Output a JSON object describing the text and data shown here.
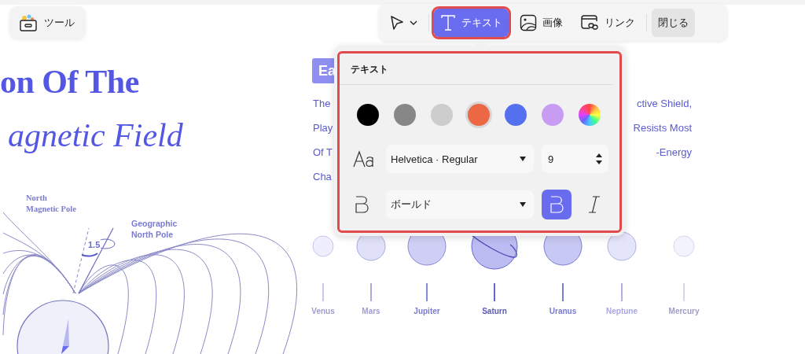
{
  "tool_button": {
    "label": "ツール"
  },
  "toolbar": {
    "items": [
      {
        "kind": "select",
        "selected": false
      },
      {
        "kind": "text",
        "label": "テキスト",
        "selected": true
      },
      {
        "kind": "image",
        "label": "画像",
        "selected": false
      },
      {
        "kind": "link",
        "label": "リンク",
        "selected": false
      },
      {
        "kind": "close",
        "label": "閉じる",
        "selected": false
      }
    ]
  },
  "text_popover": {
    "title": "テキスト",
    "colors": [
      {
        "kind": "solid",
        "color": "#000000",
        "selected": false
      },
      {
        "kind": "solid",
        "color": "#878787",
        "selected": false
      },
      {
        "kind": "solid",
        "color": "#cdcdcd",
        "selected": false
      },
      {
        "kind": "solid",
        "color": "#ec6744",
        "selected": true
      },
      {
        "kind": "solid",
        "color": "#5470ef",
        "selected": false
      },
      {
        "kind": "solid",
        "color": "#c99cf4",
        "selected": false
      },
      {
        "kind": "spectrum",
        "selected": false
      }
    ],
    "font": "Helvetica · Regular",
    "size": "9",
    "weight": "ボールド",
    "bold": true,
    "italic": false
  },
  "canvas": {
    "heading_lines": [
      "on Of The",
      "agnetic Field"
    ],
    "badge": "Ea",
    "paragraph_left": [
      "The",
      "Play",
      "Of T",
      "Cha"
    ],
    "paragraph_right": [
      "ctive Shield,",
      "Resists Most",
      "-Energy"
    ],
    "diagram_labels": {
      "magnetic_pole": "North\nMagnetic Pole",
      "geographic_pole": "Geographic\nNorth Pole",
      "angle": "1.5"
    },
    "planets": [
      {
        "name": "Venus"
      },
      {
        "name": "Mars"
      },
      {
        "name": "Jupiter"
      },
      {
        "name": "Saturn"
      },
      {
        "name": "Uranus"
      },
      {
        "name": "Neptune"
      },
      {
        "name": "Mercury"
      }
    ]
  }
}
